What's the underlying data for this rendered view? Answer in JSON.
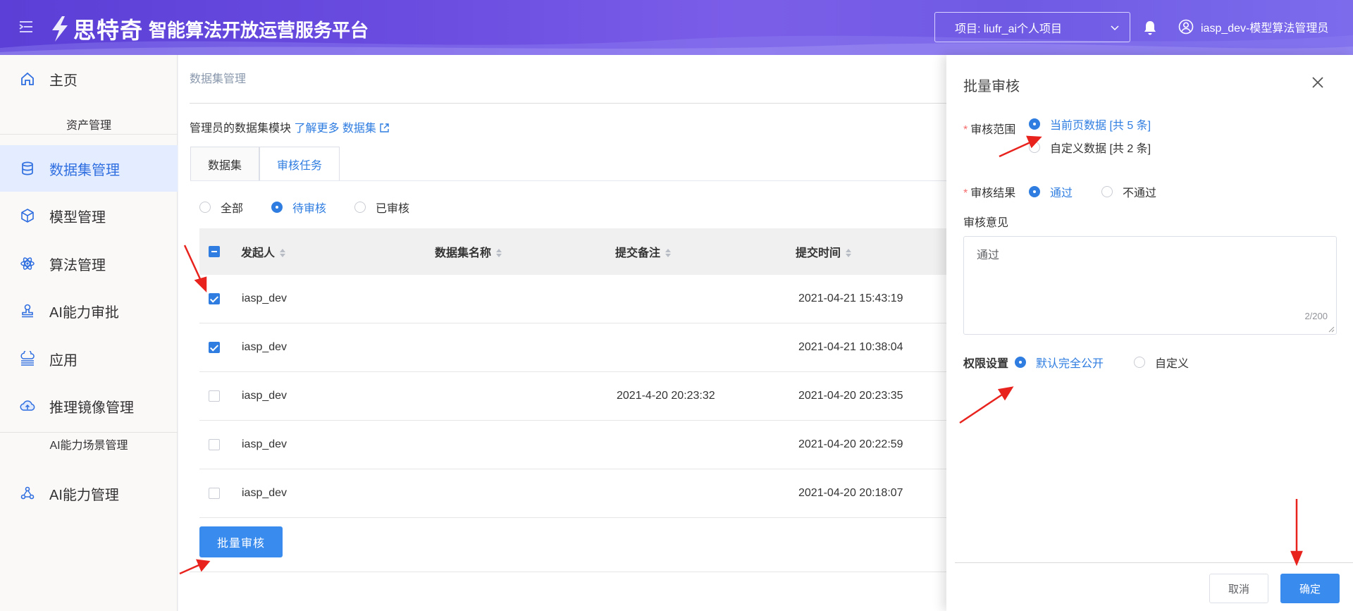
{
  "header": {
    "brand": "思特奇",
    "platform_name": "智能算法开放运营服务平台",
    "project_label": "项目: liufr_ai个人项目",
    "user_label": "iasp_dev-模型算法管理员"
  },
  "sidebar": {
    "home": "主页",
    "group_assets": "资产管理",
    "datasets": "数据集管理",
    "models": "模型管理",
    "algorithms": "算法管理",
    "ai_approval": "AI能力审批",
    "apps": "应用",
    "inference_images": "推理镜像管理",
    "group_scenes": "AI能力场景管理",
    "ai_capability": "AI能力管理"
  },
  "main": {
    "breadcrumb": "数据集管理",
    "desc_prefix": "管理员的数据集模块",
    "desc_link": "了解更多 数据集",
    "tabs": [
      "数据集",
      "审核任务"
    ],
    "filters": [
      "全部",
      "待审核",
      "已审核"
    ],
    "columns": [
      "发起人",
      "数据集名称",
      "提交备注",
      "提交时间"
    ],
    "rows": [
      {
        "initiator": "iasp_dev",
        "name": "",
        "note": "",
        "time": "2021-04-21 15:43:19",
        "checked": true
      },
      {
        "initiator": "iasp_dev",
        "name": "",
        "note": "",
        "time": "2021-04-21 10:38:04",
        "checked": true
      },
      {
        "initiator": "iasp_dev",
        "name": "",
        "note": "2021-4-20 20:23:32",
        "time": "2021-04-20 20:23:35",
        "checked": false
      },
      {
        "initiator": "iasp_dev",
        "name": "",
        "note": "",
        "time": "2021-04-20 20:22:59",
        "checked": false
      },
      {
        "initiator": "iasp_dev",
        "name": "",
        "note": "",
        "time": "2021-04-20 20:18:07",
        "checked": false
      }
    ],
    "batch_button": "批量审核"
  },
  "drawer": {
    "title": "批量审核",
    "scope_label": "审核范围",
    "scope_current": "当前页数据 [共 5 条]",
    "scope_custom": "自定义数据 [共 2 条]",
    "result_label": "审核结果",
    "result_pass": "通过",
    "result_fail": "不通过",
    "opinion_label": "审核意见",
    "opinion_value": "通过",
    "opinion_counter": "2/200",
    "perm_label": "权限设置",
    "perm_default": "默认完全公开",
    "perm_custom": "自定义",
    "cancel": "取消",
    "confirm": "确定"
  },
  "colors": {
    "accent": "#2f7de0",
    "button": "#3a8bee",
    "header": "#6a4ce0",
    "annotation_arrow": "#e8231e"
  }
}
